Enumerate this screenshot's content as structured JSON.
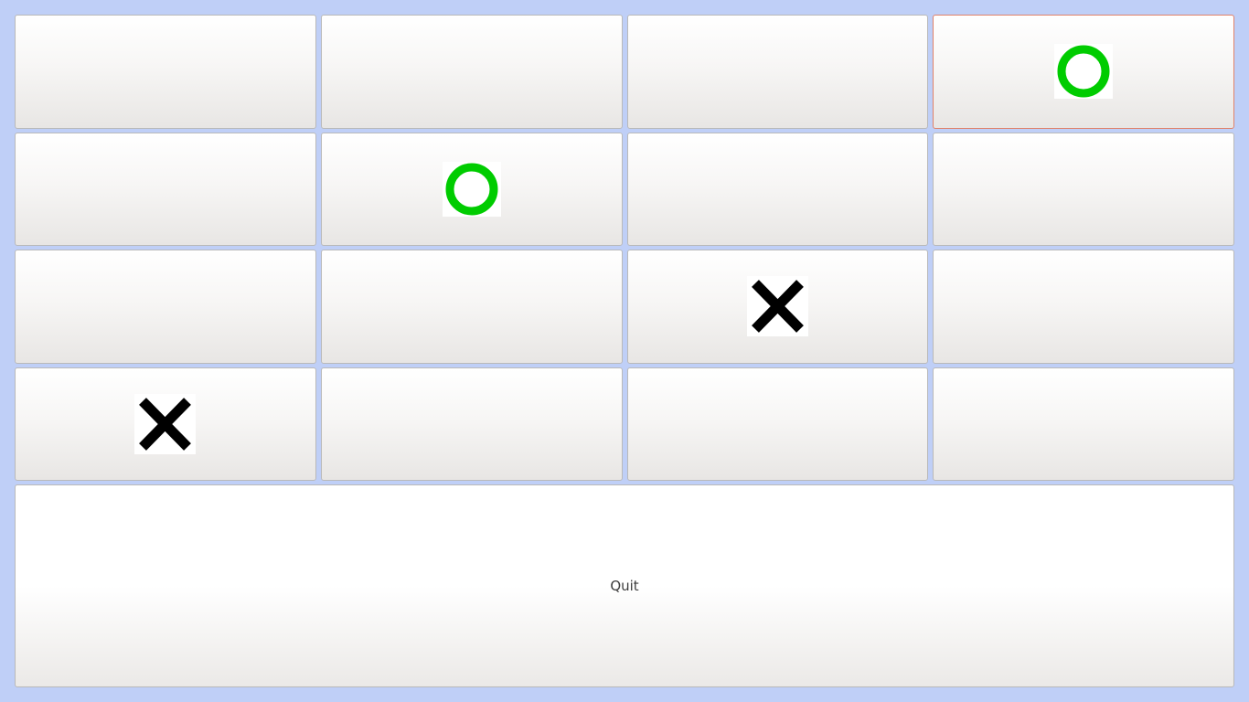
{
  "board": {
    "rows": 4,
    "cols": 4,
    "focused_cell": 3,
    "cells": [
      "",
      "",
      "",
      "O",
      "",
      "O",
      "",
      "",
      "",
      "",
      "X",
      "",
      "X",
      "",
      "",
      ""
    ]
  },
  "quit": {
    "label": "Quit"
  },
  "colors": {
    "background": "#bfcff7",
    "o_mark": "#00cc00",
    "x_mark": "#000000",
    "focus_border": "#e0826a"
  },
  "icons": {
    "O": "circle-o-icon",
    "X": "cross-x-icon"
  }
}
